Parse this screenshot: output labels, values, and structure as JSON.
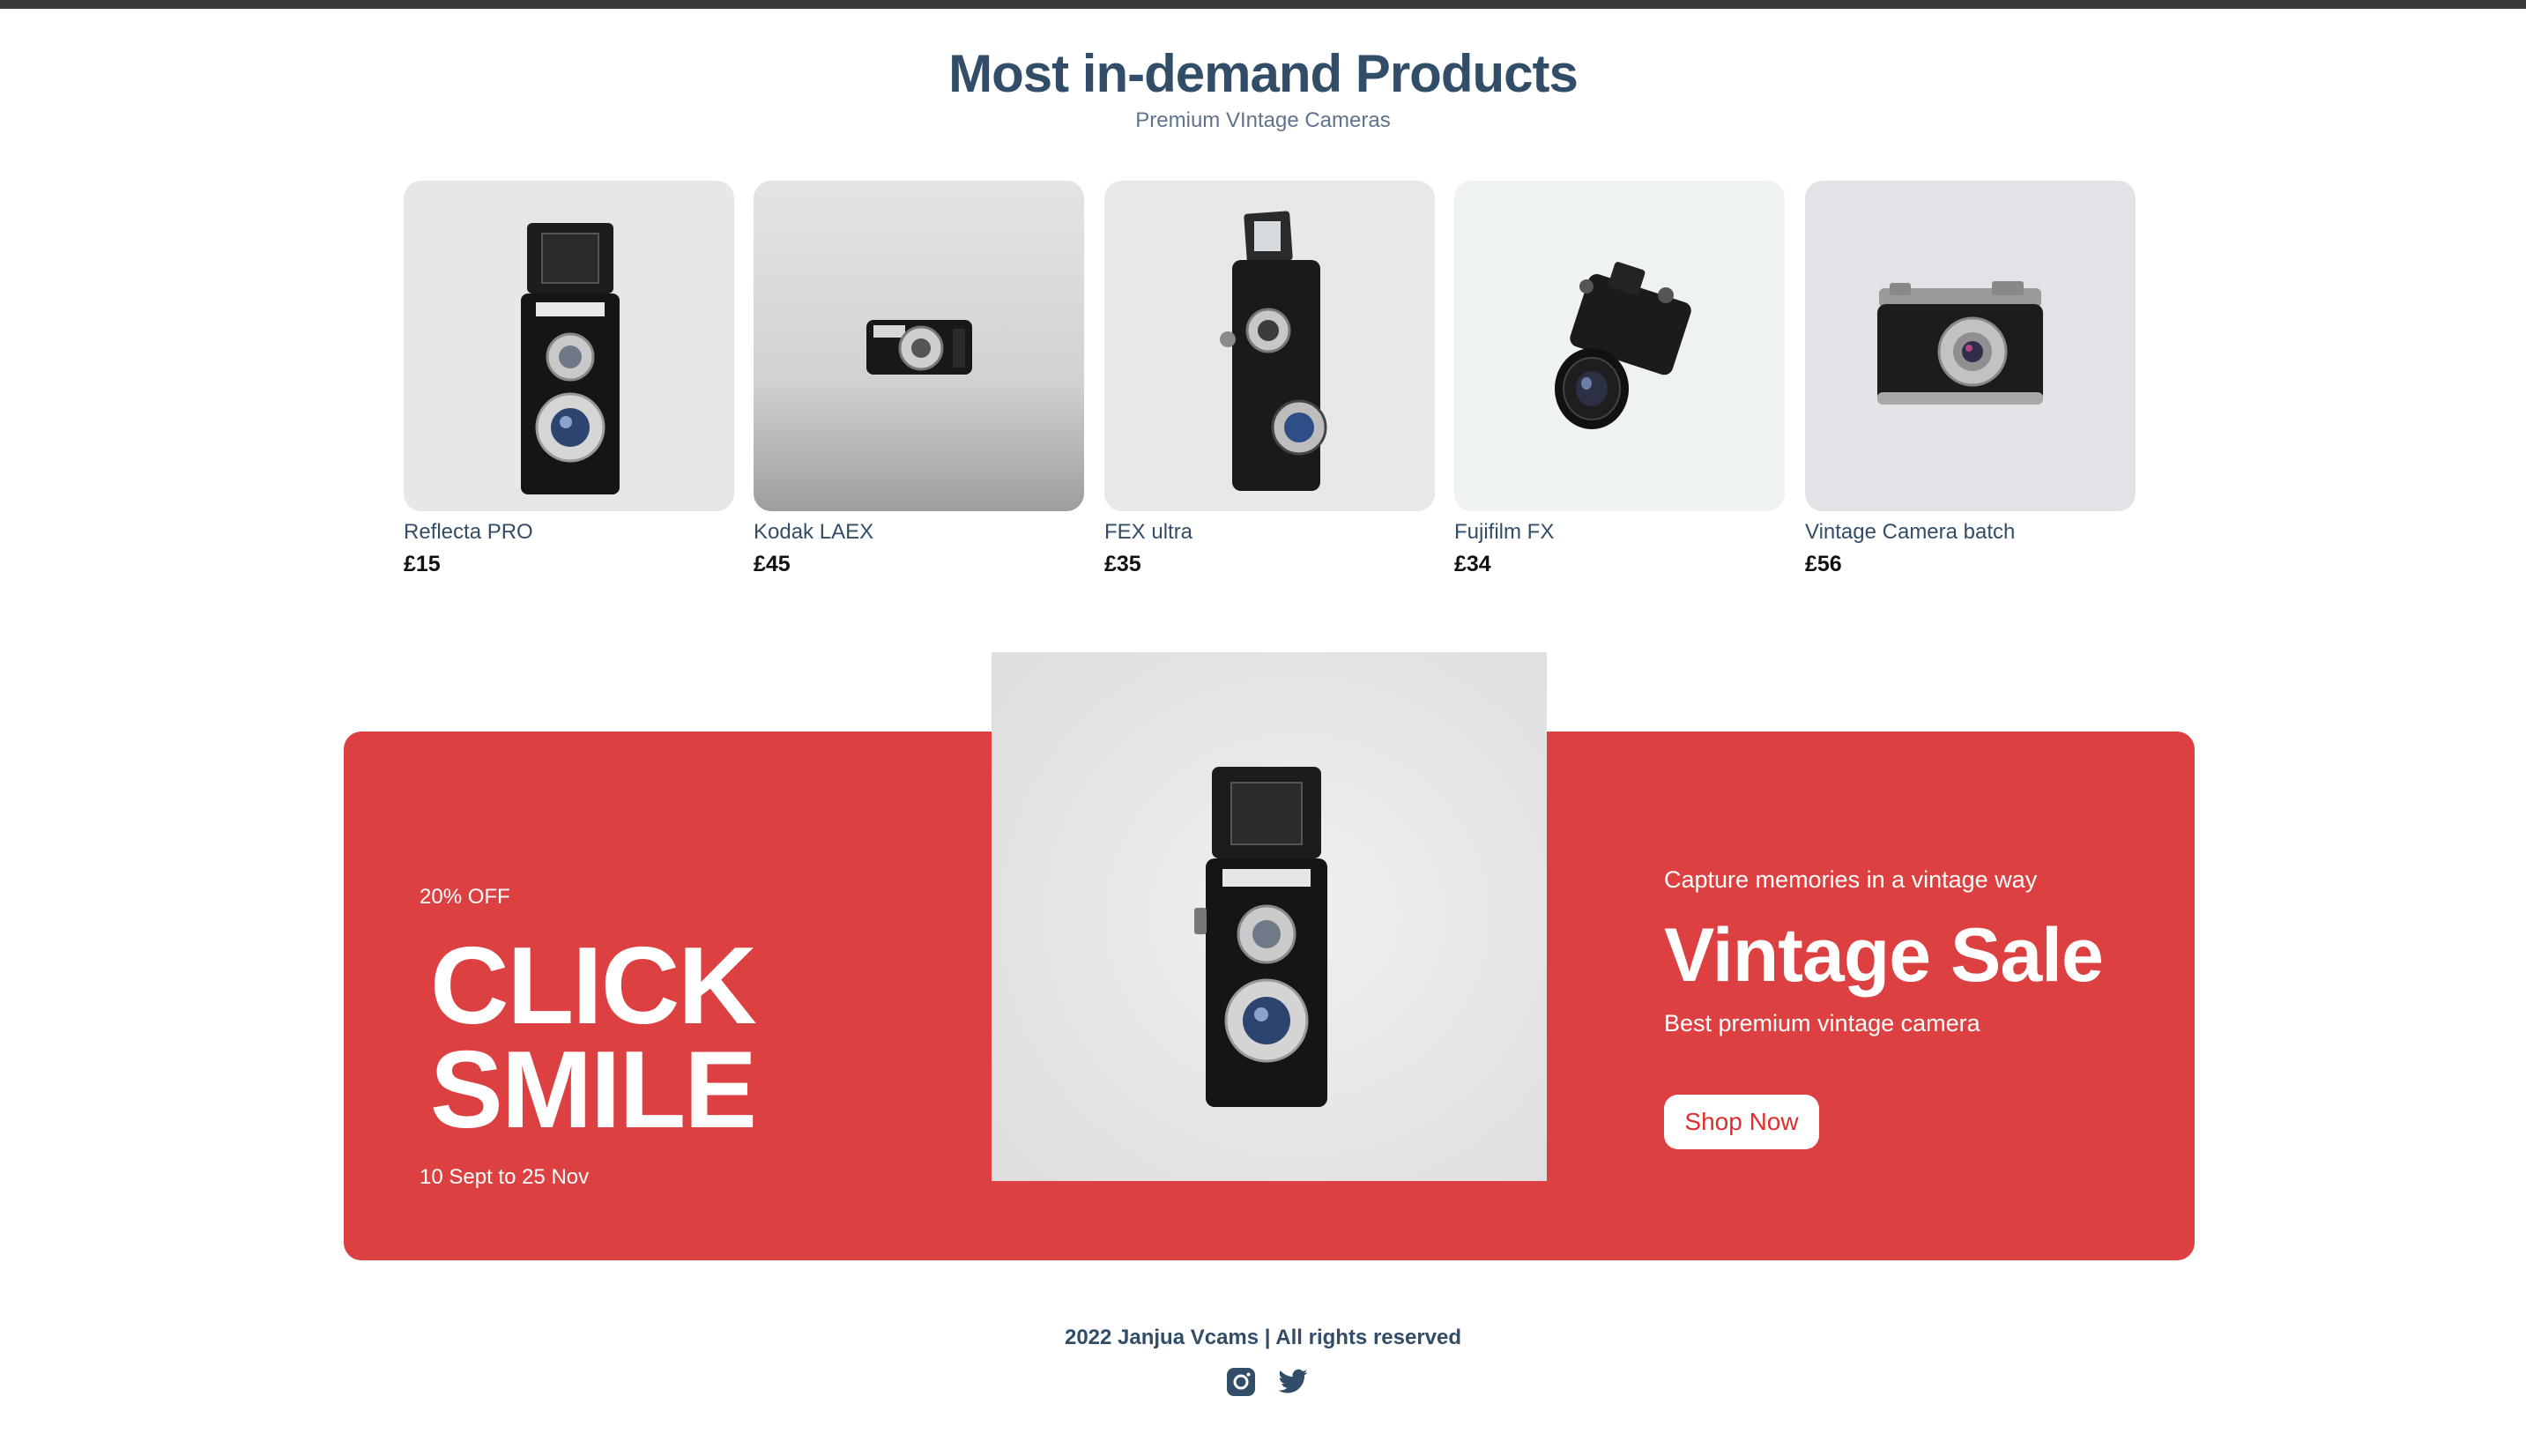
{
  "header": {
    "title": "Most in-demand Products",
    "subtitle": "Premium VIntage Cameras"
  },
  "products": [
    {
      "name": "Reflecta PRO",
      "price": "£15"
    },
    {
      "name": "Kodak LAEX",
      "price": "£45"
    },
    {
      "name": "FEX ultra",
      "price": "£35"
    },
    {
      "name": "Fujifilm FX",
      "price": "£34"
    },
    {
      "name": "Vintage Camera batch",
      "price": "£56"
    }
  ],
  "banner": {
    "discount": "20% OFF",
    "large_text_1": "CLICK",
    "large_text_2": "SMILE",
    "sale_time": "10 Sept to 25 Nov",
    "small_text": "Capture memories in a vintage way",
    "mid_text": "Vintage Sale",
    "description": "Best premium vintage camera",
    "button_label": "Shop Now"
  },
  "footer": {
    "copyright": "2022 Janjua Vcams | All rights reserved",
    "icons": [
      "instagram-icon",
      "twitter-icon"
    ]
  },
  "colors": {
    "heading": "#324d67",
    "banner_red": "#dd4040",
    "button_text": "#dd2f2f"
  }
}
